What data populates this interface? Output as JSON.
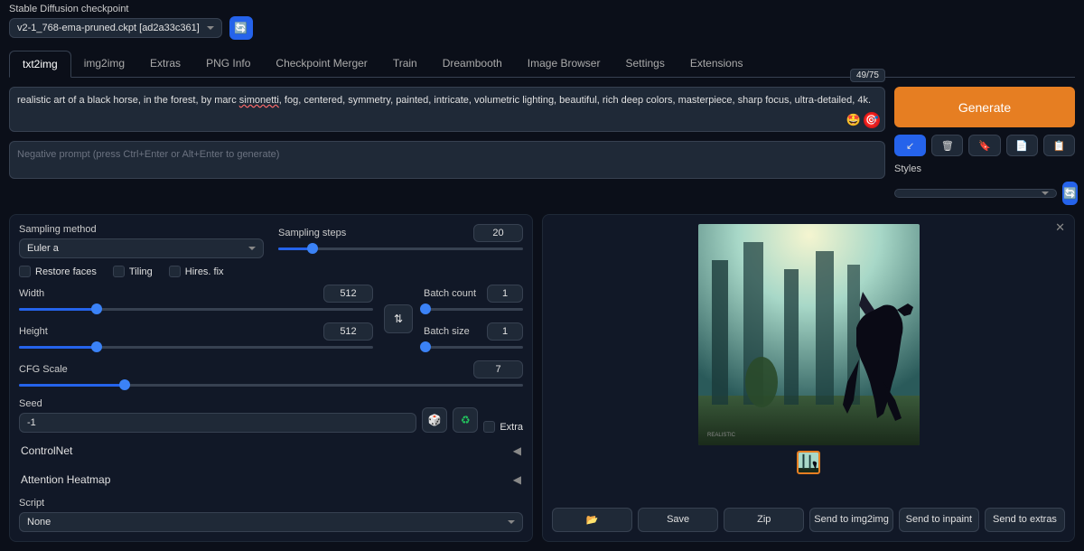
{
  "checkpoint": {
    "label": "Stable Diffusion checkpoint",
    "value": "v2-1_768-ema-pruned.ckpt [ad2a33c361]"
  },
  "tabs": [
    "txt2img",
    "img2img",
    "Extras",
    "PNG Info",
    "Checkpoint Merger",
    "Train",
    "Dreambooth",
    "Image Browser",
    "Settings",
    "Extensions"
  ],
  "active_tab": 0,
  "prompt": {
    "text_pre": "realistic art of a black horse, in the forest, by marc ",
    "text_underline": "simonetti",
    "text_post": ", fog, centered, symmetry, painted, intricate, volumetric lighting, beautiful, rich deep colors, masterpiece, sharp focus, ultra-detailed, 4k.",
    "token_counter": "49/75",
    "negative_placeholder": "Negative prompt (press Ctrl+Enter or Alt+Enter to generate)"
  },
  "generate_label": "Generate",
  "small_buttons": [
    "↙",
    "🗑",
    "🏷",
    "📋",
    "📋"
  ],
  "styles": {
    "label": "Styles"
  },
  "sampling": {
    "method_label": "Sampling method",
    "method_value": "Euler a",
    "steps_label": "Sampling steps",
    "steps_value": "20",
    "steps_pct": 14
  },
  "checkboxes": {
    "restore": "Restore faces",
    "tiling": "Tiling",
    "hires": "Hires. fix"
  },
  "dims": {
    "width_label": "Width",
    "width_value": "512",
    "width_pct": 22,
    "height_label": "Height",
    "height_value": "512",
    "height_pct": 22
  },
  "batch": {
    "count_label": "Batch count",
    "count_value": "1",
    "count_pct": 2,
    "size_label": "Batch size",
    "size_value": "1",
    "size_pct": 2
  },
  "cfg": {
    "label": "CFG Scale",
    "value": "7",
    "pct": 21
  },
  "seed": {
    "label": "Seed",
    "value": "-1",
    "extra_label": "Extra"
  },
  "accordions": {
    "controlnet": "ControlNet",
    "attention": "Attention Heatmap",
    "script_label": "Script",
    "script_value": "None"
  },
  "output": {
    "buttons": {
      "folder": "📂",
      "save": "Save",
      "zip": "Zip",
      "send_img2img": "Send to img2img",
      "send_inpaint": "Send to inpaint",
      "send_extras": "Send to extras"
    }
  }
}
